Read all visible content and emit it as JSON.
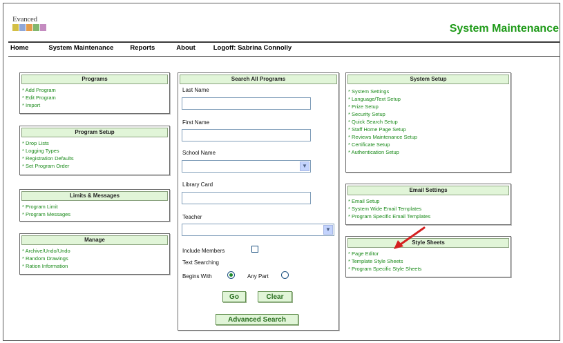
{
  "header": {
    "logo_text": "Evanced",
    "title": "System Maintenance"
  },
  "menu": [
    {
      "label": "Home"
    },
    {
      "label": "System Maintenance"
    },
    {
      "label": "Reports"
    },
    {
      "label": "About"
    },
    {
      "label": "Logoff: Sabrina Connolly"
    }
  ],
  "panels": {
    "programs": {
      "title": "Programs",
      "items": [
        "Add Program",
        "Edit Program",
        "Import"
      ]
    },
    "program_setup": {
      "title": "Program Setup",
      "items": [
        "Drop Lists",
        "Logging Types",
        "Registration Defaults",
        "Set Program Order"
      ]
    },
    "limits": {
      "title": "Limits & Messages",
      "items": [
        "Program Limit",
        "Program Messages"
      ]
    },
    "manage": {
      "title": "Manage",
      "items": [
        "Archive/Undo/Undo",
        "Random Drawings",
        "Ration Information"
      ]
    },
    "system_setup": {
      "title": "System Setup",
      "items": [
        "System Settings",
        "Language/Text Setup",
        "Prize Setup",
        "Security Setup",
        "Quick Search Setup",
        "Staff Home Page Setup",
        "Reviews Maintenance Setup",
        "Certificate Setup",
        "Authentication Setup"
      ]
    },
    "email_settings": {
      "title": "Email Settings",
      "items": [
        "Email Setup",
        "System Wide Email Templates",
        "Program Specific Email Templates"
      ]
    },
    "style_sheets": {
      "title": "Style Sheets",
      "items": [
        "Page Editor",
        "Template Style Sheets",
        "Program Specific Style Sheets"
      ]
    }
  },
  "search": {
    "title": "Search All Programs",
    "last_name": "Last Name",
    "first_name": "First Name",
    "school_name": "School Name",
    "library_card": "Library Card",
    "teacher": "Teacher",
    "include_members": "Include Members",
    "text_searching": "Text Searching",
    "begins_with": "Begins With",
    "any_part": "Any Part",
    "go": "Go",
    "clear": "Clear",
    "advanced": "Advanced Search"
  },
  "colors": {
    "accent_green": "#1e9a18",
    "link_green": "#1a8a1a",
    "header_fill": "#e1f5d8",
    "arrow_red": "#d42020"
  }
}
